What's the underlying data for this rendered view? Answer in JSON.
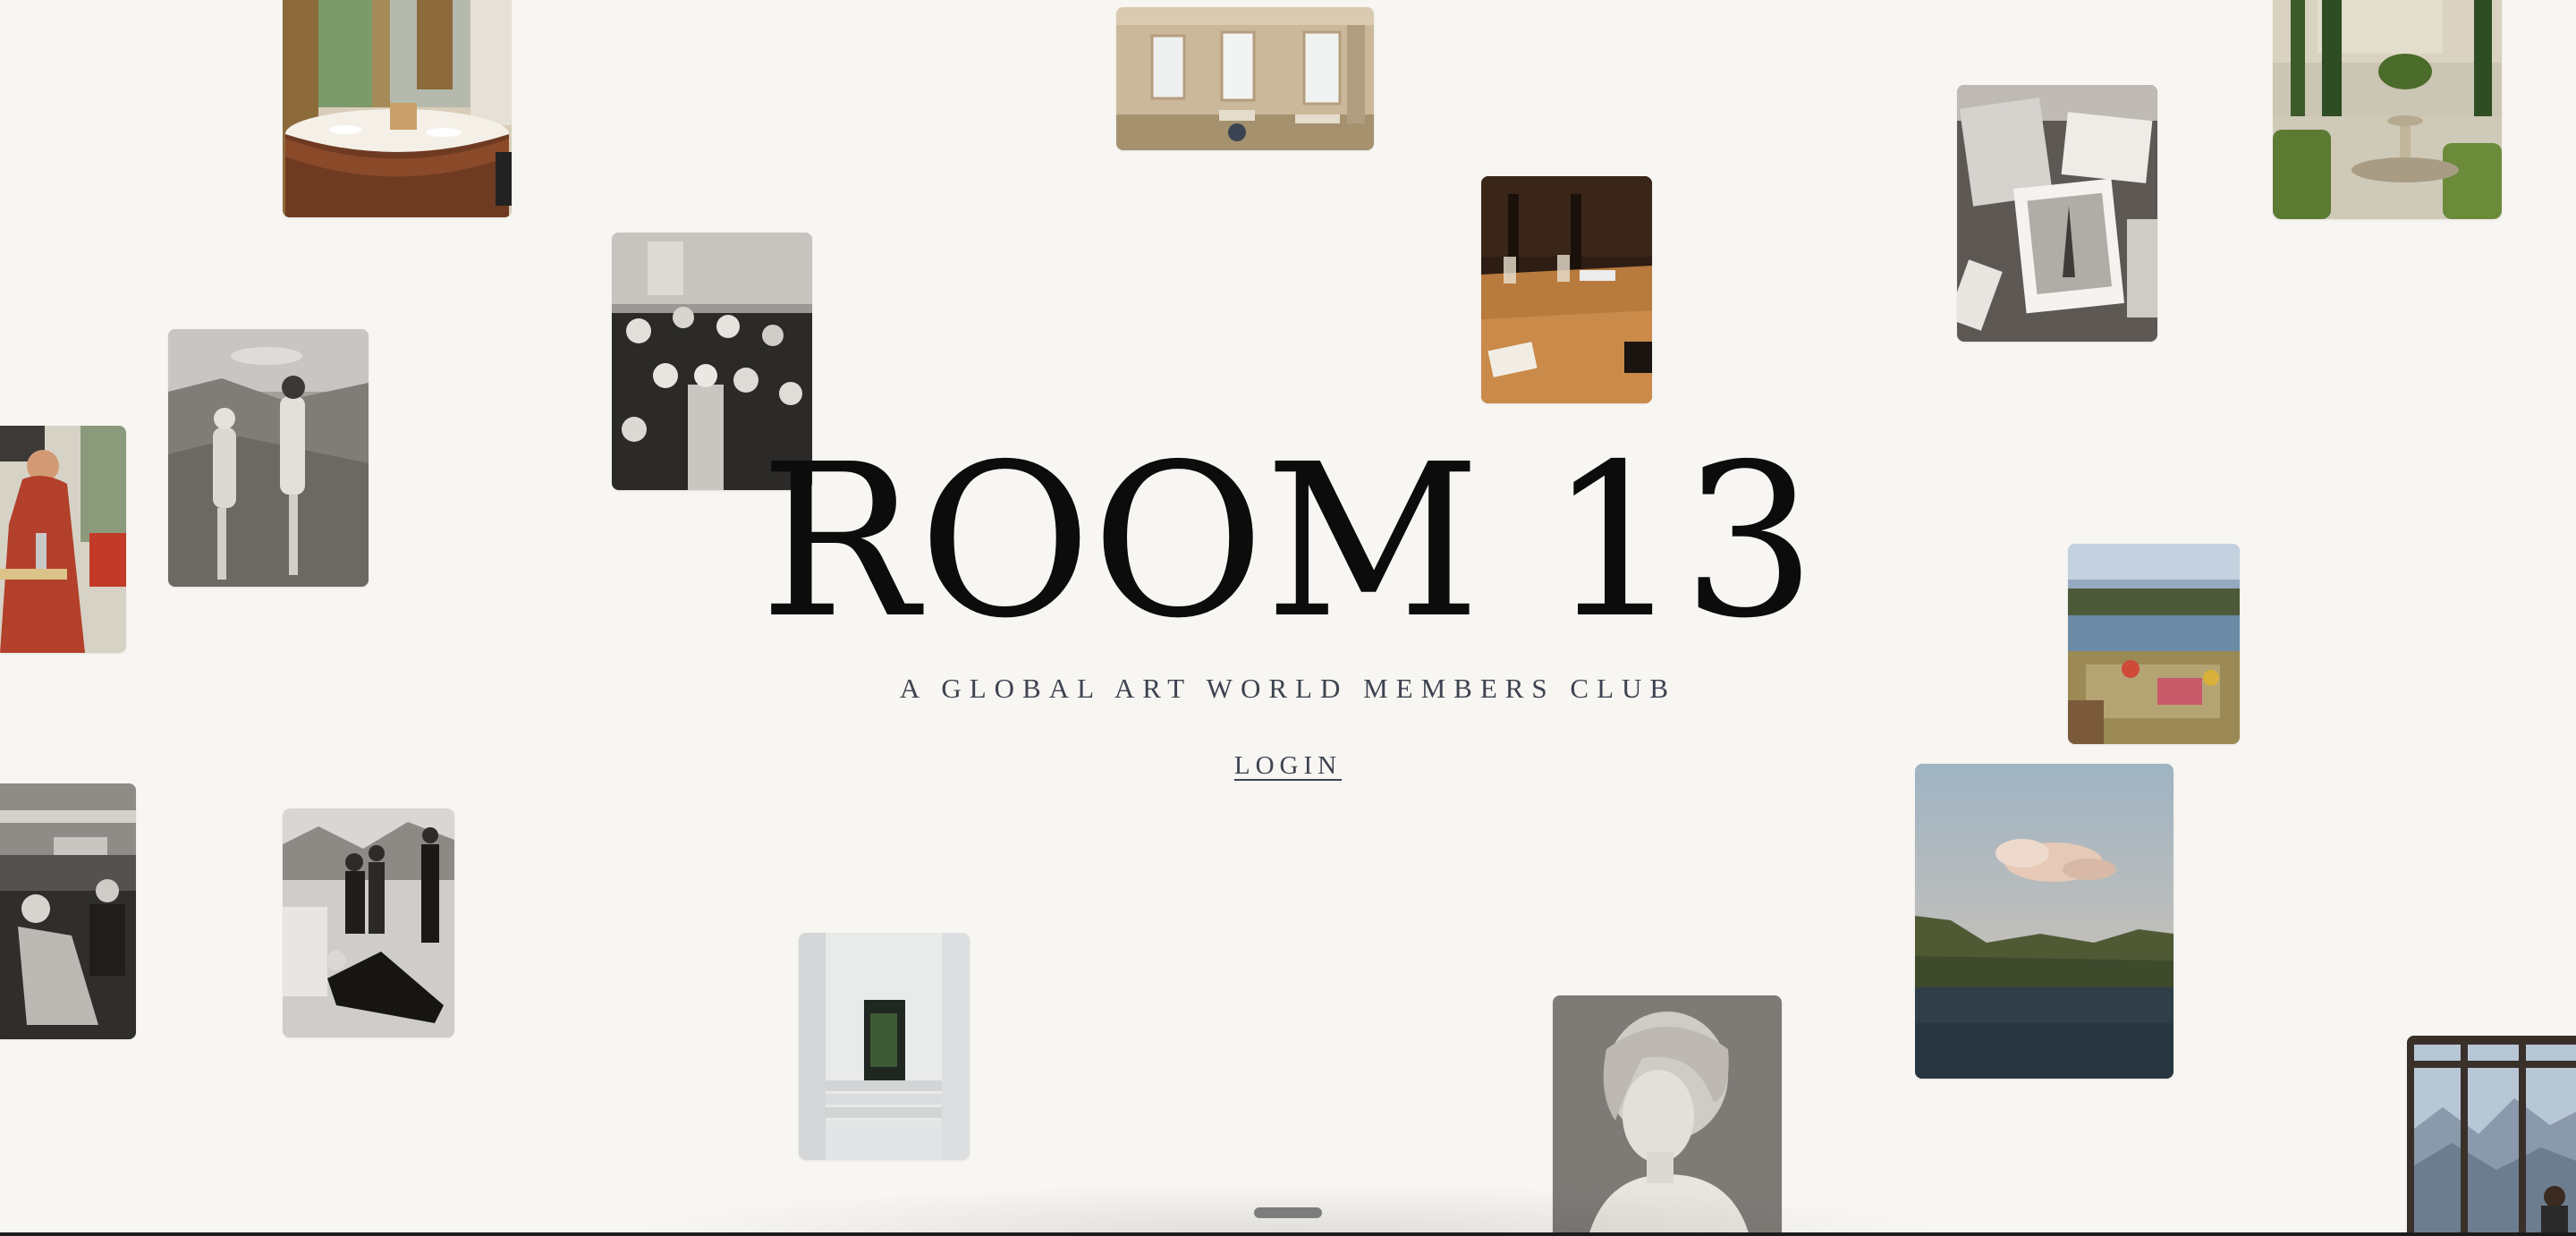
{
  "brand": {
    "title": "ROOM 13",
    "tagline": "A GLOBAL ART WORLD MEMBERS CLUB"
  },
  "actions": {
    "login_label": "LOGIN"
  },
  "gallery": {
    "photos": [
      {
        "subject": "restaurant-table",
        "style": "color"
      },
      {
        "subject": "empty-room-windows",
        "style": "color"
      },
      {
        "subject": "bar-table-cards",
        "style": "color"
      },
      {
        "subject": "photo-prints",
        "style": "bw"
      },
      {
        "subject": "garden-fountain",
        "style": "color"
      },
      {
        "subject": "party-crowd",
        "style": "bw"
      },
      {
        "subject": "women-on-rocks",
        "style": "bw"
      },
      {
        "subject": "woman-red-dress",
        "style": "color"
      },
      {
        "subject": "lake-picnic",
        "style": "color"
      },
      {
        "subject": "mountain-lake-cloud",
        "style": "color"
      },
      {
        "subject": "mountain-window-view",
        "style": "color"
      },
      {
        "subject": "lounge-scene",
        "style": "bw"
      },
      {
        "subject": "men-ski-scene",
        "style": "bw"
      },
      {
        "subject": "white-stair-doorway",
        "style": "color"
      },
      {
        "subject": "marble-bust",
        "style": "bw"
      }
    ]
  },
  "colors": {
    "background": "#f8f6f2",
    "title": "#0c0c0c",
    "text": "#3d4350"
  }
}
